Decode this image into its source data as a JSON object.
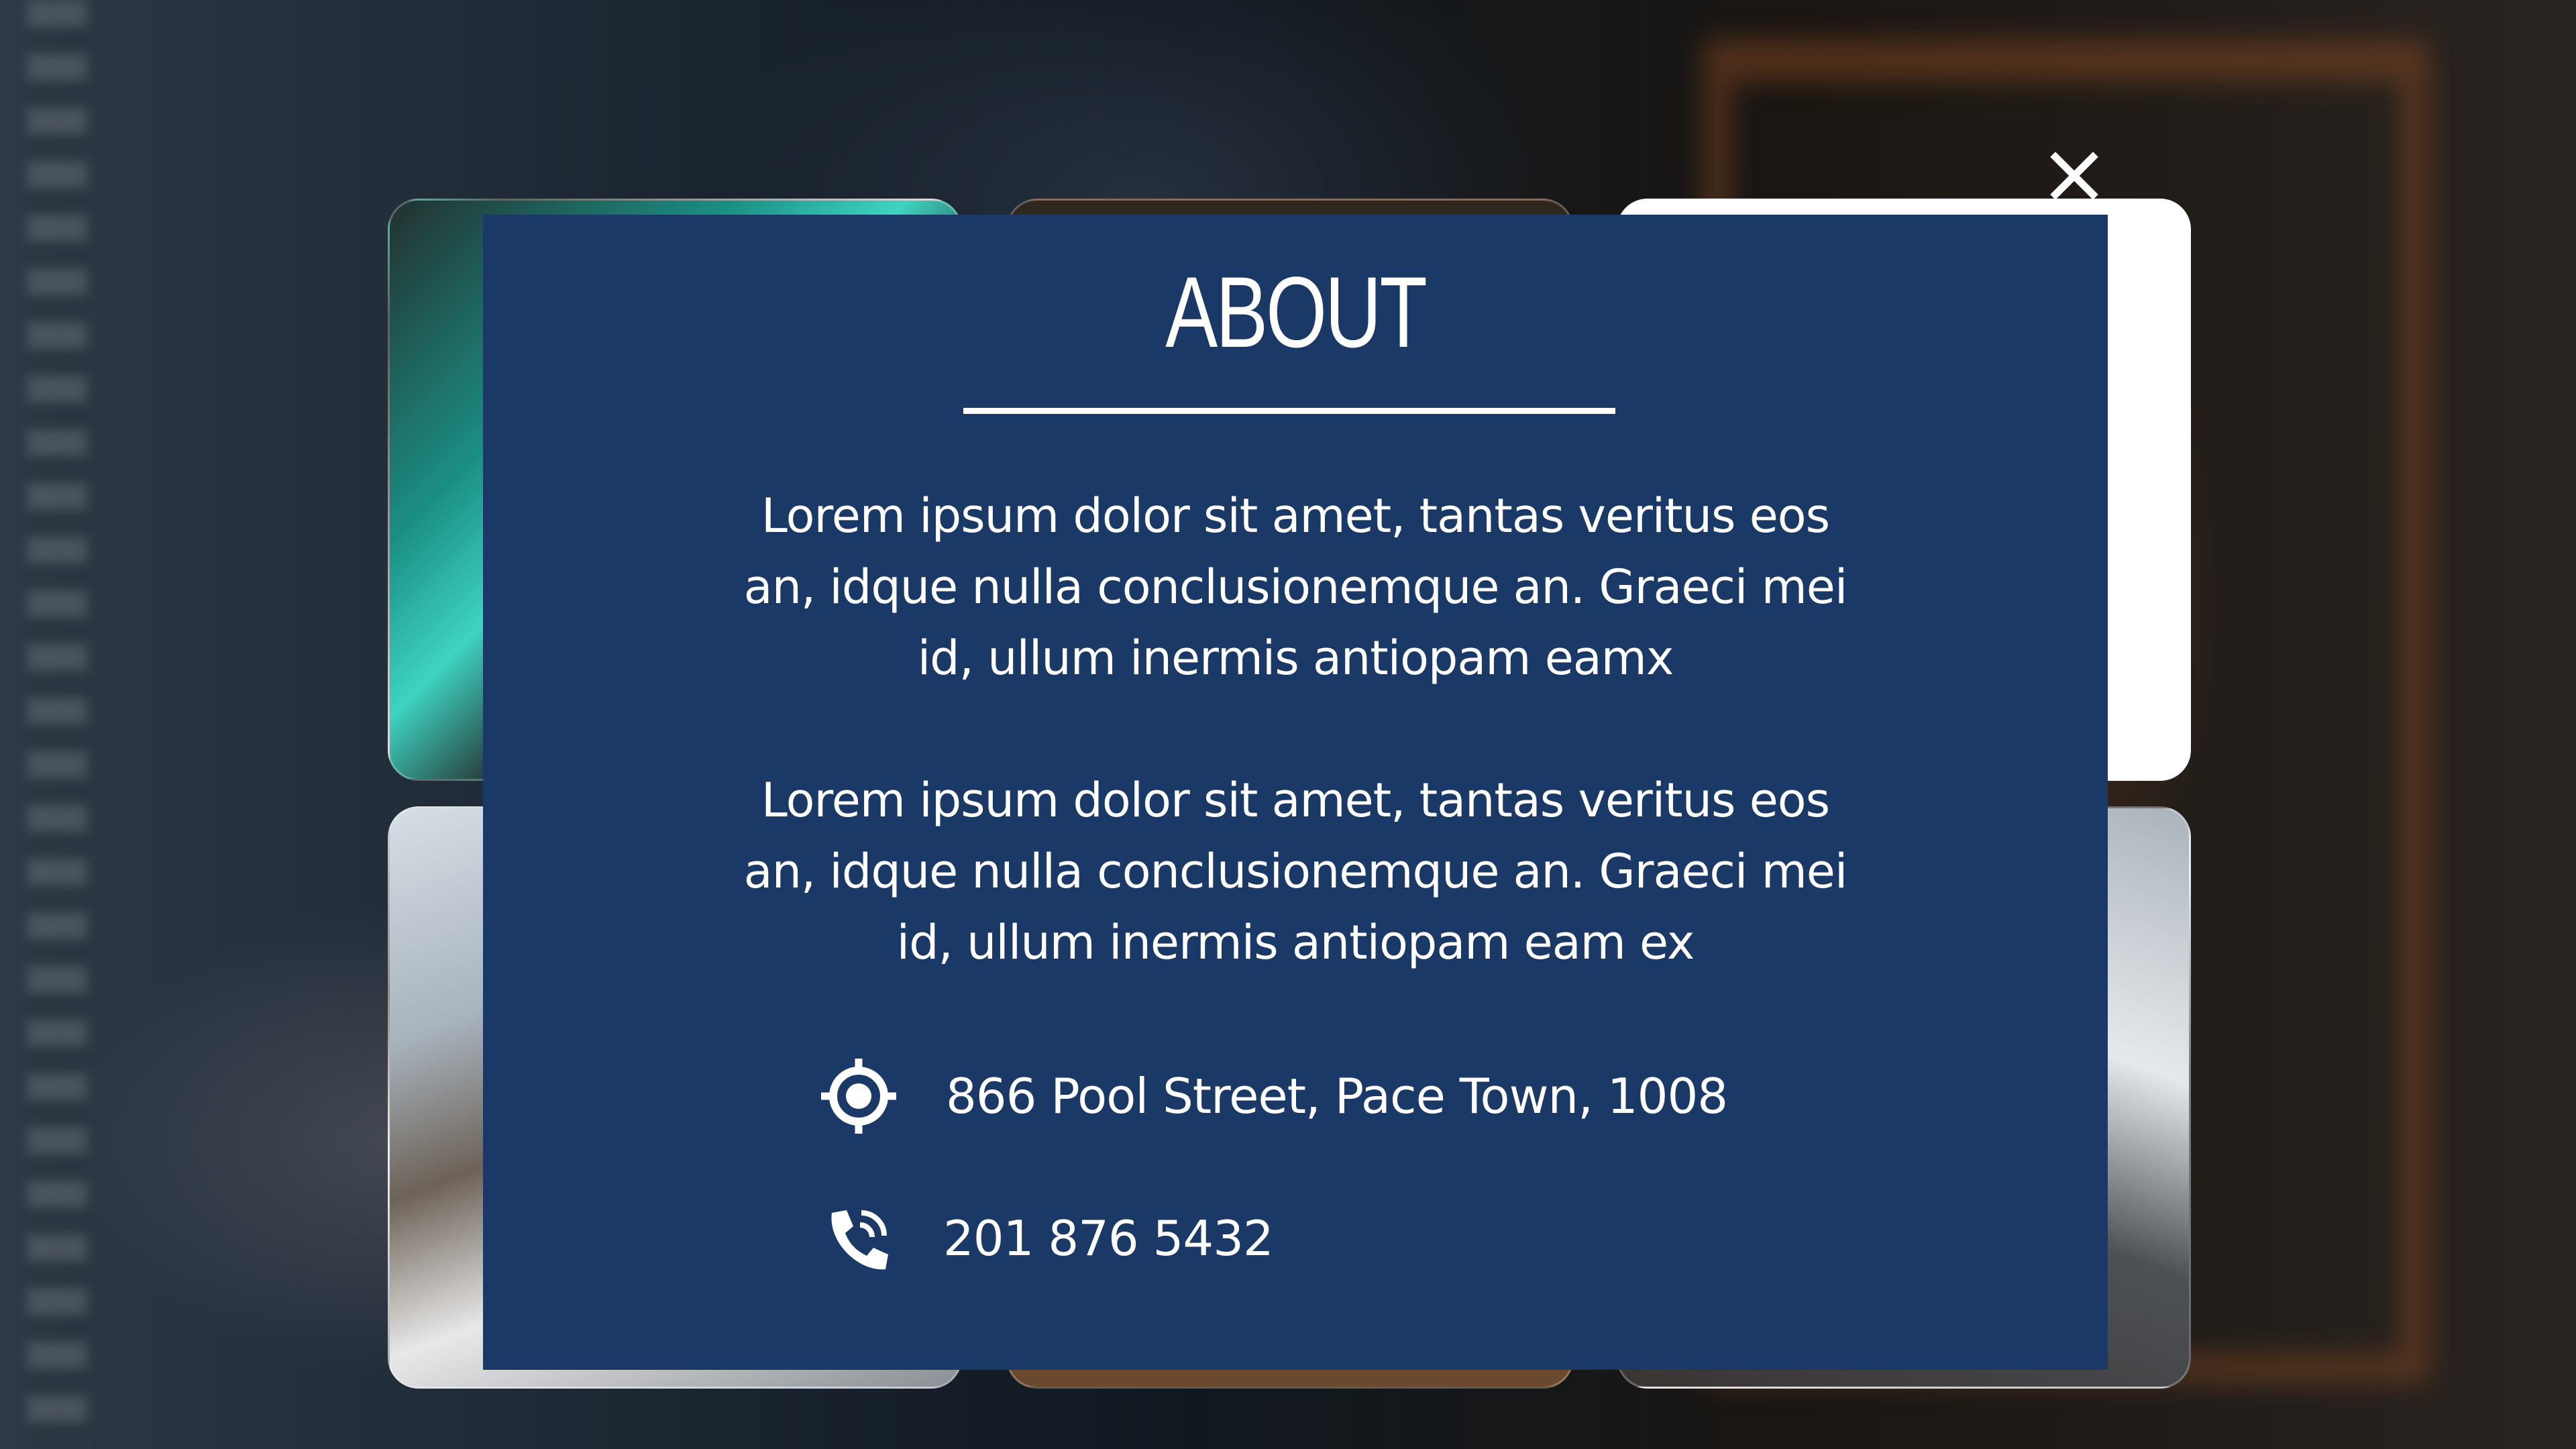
{
  "modal": {
    "title": "ABOUT",
    "paragraphs": [
      "Lorem ipsum dolor sit amet, tantas veritus eos an, idque nulla conclusionemque an. Graeci mei id, ullum inermis antiopam eamx",
      "Lorem ipsum dolor sit amet, tantas veritus eos an, idque nulla conclusionemque an. Graeci mei id, ullum inermis antiopam eam ex"
    ],
    "contact": {
      "address": "866 Pool Street, Pace Town, 1008",
      "address_icon": "location-target-icon",
      "phone": "201 876 5432",
      "phone_icon": "phone-call-icon"
    },
    "close_icon": "close-icon"
  },
  "colors": {
    "panel_background": "#1b3966",
    "text": "#ffffff"
  }
}
